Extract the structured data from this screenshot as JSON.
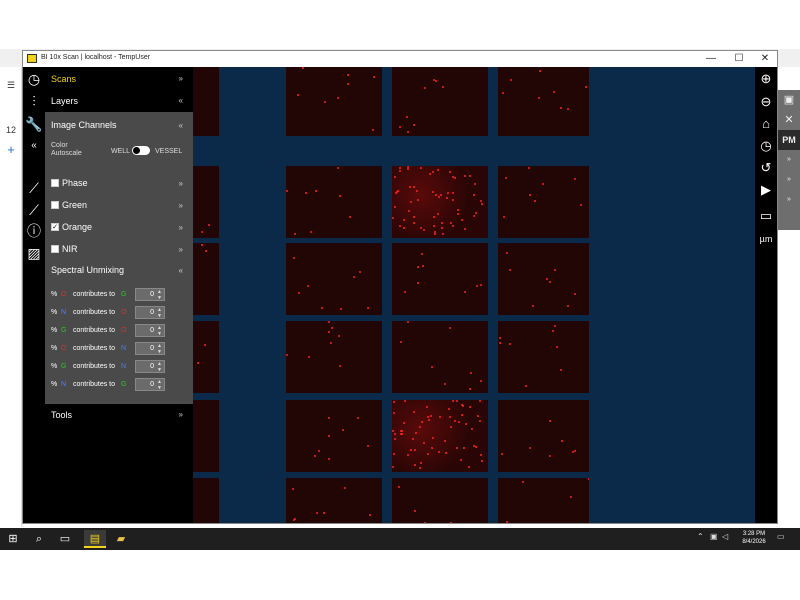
{
  "window": {
    "title": "BI 10x Scan | localhost - TempUser",
    "minimize": "—",
    "maximize": "☐",
    "close": "✕"
  },
  "background_app": {
    "tab_number": "12",
    "add": "+",
    "pm_label": "PM"
  },
  "panel": {
    "scans_label": "Scans",
    "layers_label": "Layers",
    "image_channels_label": "Image Channels",
    "collapse_glyph": "«",
    "color_autoscale_label_1": "Color",
    "color_autoscale_label_2": "Autoscale",
    "toggle_left": "WELL",
    "toggle_right": "VESSEL",
    "channels": [
      {
        "label": "Phase",
        "checked": false
      },
      {
        "label": "Green",
        "checked": false
      },
      {
        "label": "Orange",
        "checked": true
      },
      {
        "label": "NIR",
        "checked": false
      }
    ],
    "spectral_unmixing_label": "Spectral Unmixing",
    "unmix_rows": [
      {
        "pct": "%",
        "from": "O",
        "text": "contributes to",
        "to": "G",
        "value": "0"
      },
      {
        "pct": "%",
        "from": "N",
        "text": "contributes to",
        "to": "O",
        "value": "0"
      },
      {
        "pct": "%",
        "from": "G",
        "text": "contributes to",
        "to": "O",
        "value": "0"
      },
      {
        "pct": "%",
        "from": "O",
        "text": "contributes to",
        "to": "N",
        "value": "0"
      },
      {
        "pct": "%",
        "from": "G",
        "text": "contributes to",
        "to": "N",
        "value": "0"
      },
      {
        "pct": "%",
        "from": "N",
        "text": "contributes to",
        "to": "G",
        "value": "0"
      }
    ],
    "tools_label": "Tools"
  },
  "taskbar": {
    "time": "3:28 PM",
    "date": "8/4/2026"
  },
  "colors": {
    "accent_yellow": "#f2d21b",
    "viewer_blue": "#0b2a4a",
    "panel_gray": "#4a4a4a",
    "O": "#e03030",
    "G": "#22cc22",
    "N": "#4d7bff"
  }
}
